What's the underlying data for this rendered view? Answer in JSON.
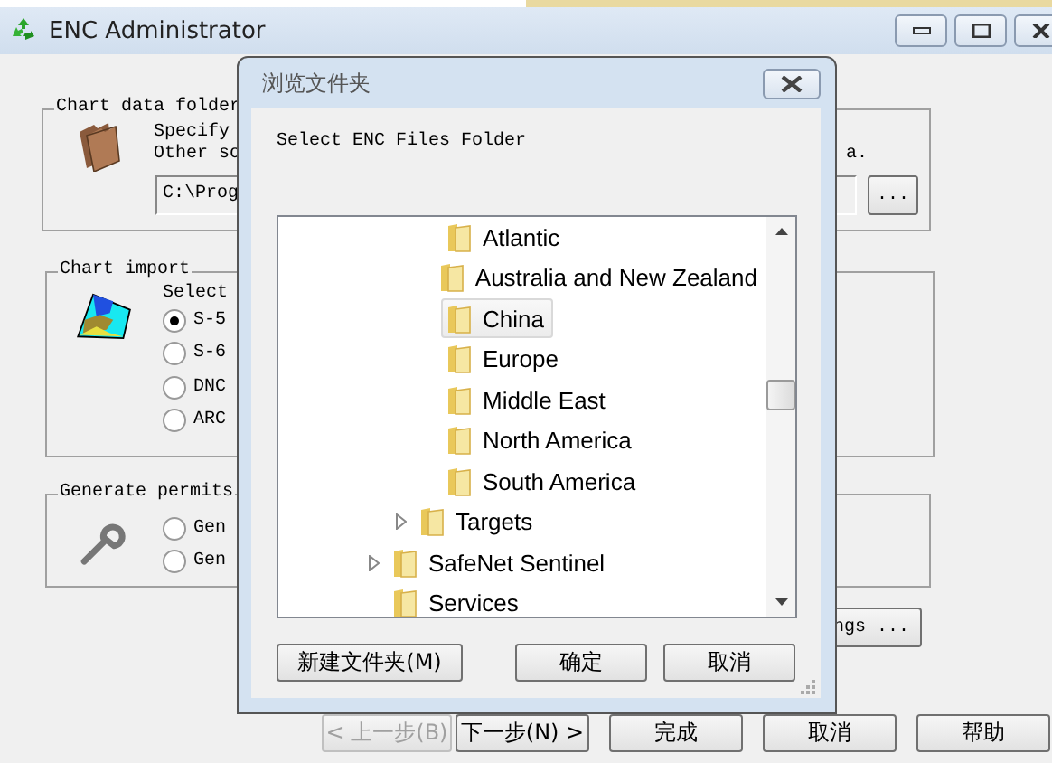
{
  "window": {
    "title": "ENC Administrator"
  },
  "chart_data_folder": {
    "title": "Chart data folder",
    "lines": [
      "Specify",
      "Other so"
    ],
    "trailing_text": "a.",
    "path": "C:\\Prog",
    "browse_button": "..."
  },
  "chart_import": {
    "title": "Chart import",
    "prompt": "Select",
    "options": [
      {
        "label": "S-5",
        "selected": true
      },
      {
        "label": "S-6",
        "selected": false
      },
      {
        "label": "DNC",
        "selected": false
      },
      {
        "label": "ARC",
        "selected": false
      }
    ]
  },
  "generate_permits": {
    "title": "Generate permits",
    "options": [
      {
        "label": "Gen",
        "selected": false
      },
      {
        "label": "Gen",
        "selected": false
      }
    ]
  },
  "settings_button": "ngs ...",
  "wizard_buttons": [
    {
      "label": "< 上一步(B)",
      "disabled": true
    },
    {
      "label": "下一步(N) >",
      "disabled": false
    },
    {
      "label": "完成",
      "disabled": false
    },
    {
      "label": "取消",
      "disabled": false
    },
    {
      "label": "帮助",
      "disabled": false
    }
  ],
  "dialog": {
    "title": "浏览文件夹",
    "prompt": "Select ENC Files Folder",
    "tree": [
      {
        "children": [
          {
            "children": [
              {
                "label": "Atlantic",
                "selected": false
              },
              {
                "label": "Australia and New Zealand",
                "selected": false
              },
              {
                "label": "China",
                "selected": true
              },
              {
                "label": "Europe",
                "selected": false
              },
              {
                "label": "Middle East",
                "selected": false
              },
              {
                "label": "North America",
                "selected": false
              },
              {
                "label": "South America",
                "selected": false
              }
            ]
          },
          {
            "label": "Targets",
            "selected": false,
            "expanded": false
          }
        ]
      },
      {
        "label": "SafeNet Sentinel",
        "selected": false,
        "expanded": false
      },
      {
        "label": "Services",
        "selected": false
      }
    ],
    "buttons": [
      "新建文件夹(M)",
      "确定",
      "取消"
    ]
  }
}
